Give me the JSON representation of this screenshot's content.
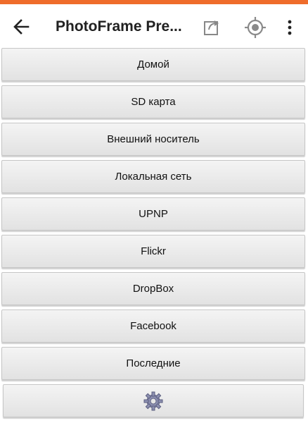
{
  "colors": {
    "accent": "#ef6c2b",
    "button_top": "#f4f4f4",
    "button_bottom": "#e2e2e2",
    "text": "#111111"
  },
  "appbar": {
    "title": "PhotoFrame Pre...",
    "back_icon": "arrow-left-icon",
    "share_icon": "share-icon",
    "target_icon": "gps-target-icon",
    "more_icon": "more-vertical-icon"
  },
  "menu": {
    "items": [
      {
        "label": "Домой"
      },
      {
        "label": "SD карта"
      },
      {
        "label": "Внешний носитель"
      },
      {
        "label": "Локальная сеть"
      },
      {
        "label": "UPNP"
      },
      {
        "label": "Flickr"
      },
      {
        "label": "DropBox"
      },
      {
        "label": "Facebook"
      },
      {
        "label": "Последние"
      }
    ],
    "settings_icon": "gear-icon"
  }
}
